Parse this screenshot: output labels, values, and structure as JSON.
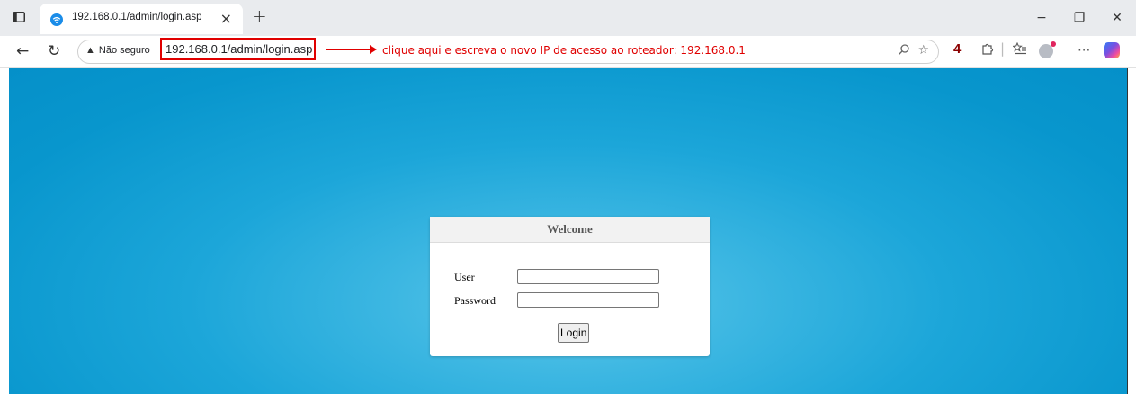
{
  "tab": {
    "title": "192.168.0.1/admin/login.asp",
    "close_glyph": "×",
    "new_tab_glyph": "+"
  },
  "window": {
    "minimize": "−",
    "restore": "❐",
    "close": "✕"
  },
  "toolbar": {
    "back": "←",
    "refresh": "↻",
    "security_label": "Não seguro",
    "url": "192.168.0.1/admin/login.asp",
    "annotation": "clique aqui e escreva o novo IP de acesso ao roteador: 192.168.0.1",
    "step_number": "4",
    "more": "···"
  },
  "icons": {
    "tab_toggle": "tab-actions-icon",
    "favicon": "wifi-icon",
    "search": "search-icon",
    "favorite": "star-icon",
    "extensions": "puzzle-icon",
    "favorites_list": "favorites-icon",
    "profile": "profile-icon",
    "copilot": "copilot-icon"
  },
  "login": {
    "header": "Welcome",
    "user_label": "User",
    "password_label": "Password",
    "user_value": "",
    "password_value": "",
    "button_label": "Login"
  },
  "colors": {
    "annotation": "#e00000",
    "background_center": "#5cc7e9",
    "background_edge": "#0590c9"
  }
}
